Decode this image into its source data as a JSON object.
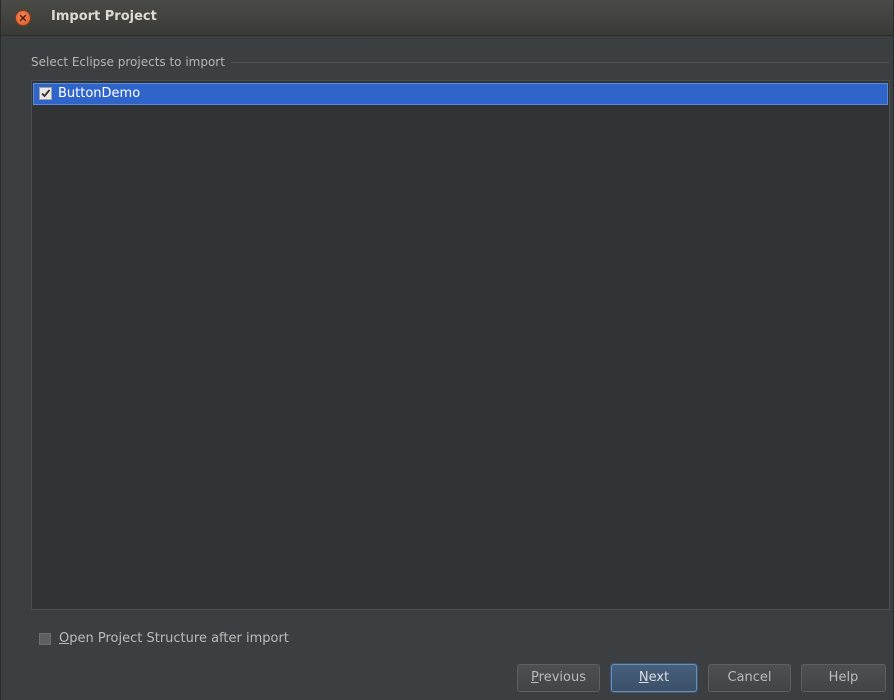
{
  "window": {
    "title": "Import Project"
  },
  "section": {
    "label": "Select Eclipse projects to import"
  },
  "projects": [
    {
      "label": "ButtonDemo",
      "checked": true,
      "selected": true
    }
  ],
  "option": {
    "mnemonic": "O",
    "rest": "pen Project Structure after import",
    "checked": false
  },
  "buttons": {
    "previous": {
      "mnemonic": "P",
      "rest": "revious"
    },
    "next": {
      "mnemonic": "N",
      "rest": "ext"
    },
    "cancel": "Cancel",
    "help": "Help"
  },
  "colors": {
    "selection": "#2f65ca",
    "background": "#3c3f41",
    "close_button": "#e95420"
  }
}
